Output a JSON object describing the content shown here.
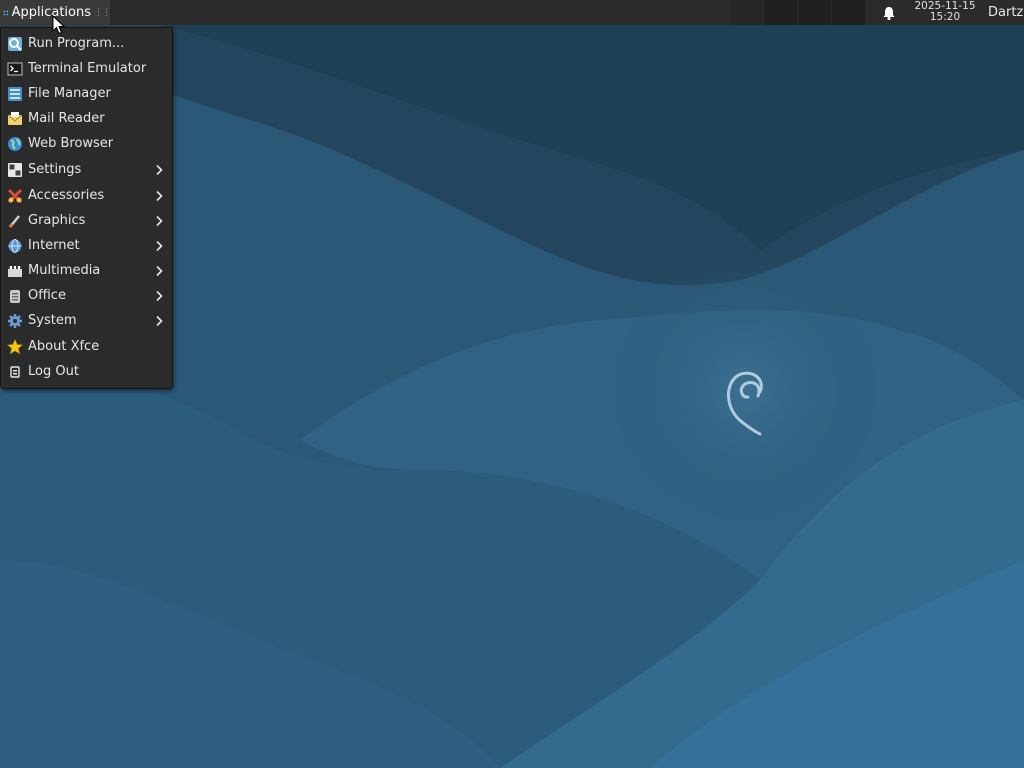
{
  "panel": {
    "applications_label": "Applications",
    "clock_date": "2025-11-15",
    "clock_time": "15:20",
    "user_name": "Dartz"
  },
  "menu": {
    "items": [
      {
        "label": "Run Program...",
        "icon": "run-program-icon",
        "submenu": false
      },
      {
        "label": "Terminal Emulator",
        "icon": "terminal-icon",
        "submenu": false
      },
      {
        "label": "File Manager",
        "icon": "file-manager-icon",
        "submenu": false
      },
      {
        "label": "Mail Reader",
        "icon": "mail-icon",
        "submenu": false
      },
      {
        "label": "Web Browser",
        "icon": "web-browser-icon",
        "submenu": false
      },
      {
        "label": "Settings",
        "icon": "settings-icon",
        "submenu": true
      },
      {
        "label": "Accessories",
        "icon": "accessories-icon",
        "submenu": true
      },
      {
        "label": "Graphics",
        "icon": "graphics-icon",
        "submenu": true
      },
      {
        "label": "Internet",
        "icon": "internet-icon",
        "submenu": true
      },
      {
        "label": "Multimedia",
        "icon": "multimedia-icon",
        "submenu": true
      },
      {
        "label": "Office",
        "icon": "office-icon",
        "submenu": true
      },
      {
        "label": "System",
        "icon": "system-icon",
        "submenu": true
      },
      {
        "label": "About Xfce",
        "icon": "star-icon",
        "submenu": false
      },
      {
        "label": "Log Out",
        "icon": "logout-icon",
        "submenu": false
      }
    ]
  },
  "colors": {
    "panel_bg": "#2b2b2b",
    "menu_bg": "#2b2b2b",
    "desktop_base": "#2a5673"
  }
}
